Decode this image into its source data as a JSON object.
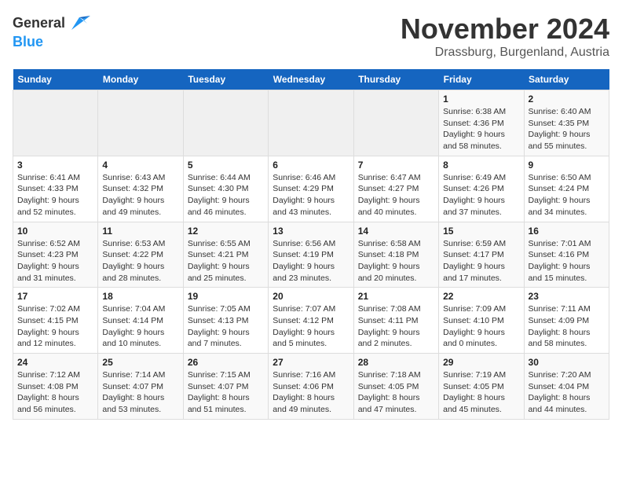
{
  "header": {
    "logo_general": "General",
    "logo_blue": "Blue",
    "month_title": "November 2024",
    "location": "Drassburg, Burgenland, Austria"
  },
  "weekdays": [
    "Sunday",
    "Monday",
    "Tuesday",
    "Wednesday",
    "Thursday",
    "Friday",
    "Saturday"
  ],
  "weeks": [
    [
      {
        "day": "",
        "details": ""
      },
      {
        "day": "",
        "details": ""
      },
      {
        "day": "",
        "details": ""
      },
      {
        "day": "",
        "details": ""
      },
      {
        "day": "",
        "details": ""
      },
      {
        "day": "1",
        "details": "Sunrise: 6:38 AM\nSunset: 4:36 PM\nDaylight: 9 hours and 58 minutes."
      },
      {
        "day": "2",
        "details": "Sunrise: 6:40 AM\nSunset: 4:35 PM\nDaylight: 9 hours and 55 minutes."
      }
    ],
    [
      {
        "day": "3",
        "details": "Sunrise: 6:41 AM\nSunset: 4:33 PM\nDaylight: 9 hours and 52 minutes."
      },
      {
        "day": "4",
        "details": "Sunrise: 6:43 AM\nSunset: 4:32 PM\nDaylight: 9 hours and 49 minutes."
      },
      {
        "day": "5",
        "details": "Sunrise: 6:44 AM\nSunset: 4:30 PM\nDaylight: 9 hours and 46 minutes."
      },
      {
        "day": "6",
        "details": "Sunrise: 6:46 AM\nSunset: 4:29 PM\nDaylight: 9 hours and 43 minutes."
      },
      {
        "day": "7",
        "details": "Sunrise: 6:47 AM\nSunset: 4:27 PM\nDaylight: 9 hours and 40 minutes."
      },
      {
        "day": "8",
        "details": "Sunrise: 6:49 AM\nSunset: 4:26 PM\nDaylight: 9 hours and 37 minutes."
      },
      {
        "day": "9",
        "details": "Sunrise: 6:50 AM\nSunset: 4:24 PM\nDaylight: 9 hours and 34 minutes."
      }
    ],
    [
      {
        "day": "10",
        "details": "Sunrise: 6:52 AM\nSunset: 4:23 PM\nDaylight: 9 hours and 31 minutes."
      },
      {
        "day": "11",
        "details": "Sunrise: 6:53 AM\nSunset: 4:22 PM\nDaylight: 9 hours and 28 minutes."
      },
      {
        "day": "12",
        "details": "Sunrise: 6:55 AM\nSunset: 4:21 PM\nDaylight: 9 hours and 25 minutes."
      },
      {
        "day": "13",
        "details": "Sunrise: 6:56 AM\nSunset: 4:19 PM\nDaylight: 9 hours and 23 minutes."
      },
      {
        "day": "14",
        "details": "Sunrise: 6:58 AM\nSunset: 4:18 PM\nDaylight: 9 hours and 20 minutes."
      },
      {
        "day": "15",
        "details": "Sunrise: 6:59 AM\nSunset: 4:17 PM\nDaylight: 9 hours and 17 minutes."
      },
      {
        "day": "16",
        "details": "Sunrise: 7:01 AM\nSunset: 4:16 PM\nDaylight: 9 hours and 15 minutes."
      }
    ],
    [
      {
        "day": "17",
        "details": "Sunrise: 7:02 AM\nSunset: 4:15 PM\nDaylight: 9 hours and 12 minutes."
      },
      {
        "day": "18",
        "details": "Sunrise: 7:04 AM\nSunset: 4:14 PM\nDaylight: 9 hours and 10 minutes."
      },
      {
        "day": "19",
        "details": "Sunrise: 7:05 AM\nSunset: 4:13 PM\nDaylight: 9 hours and 7 minutes."
      },
      {
        "day": "20",
        "details": "Sunrise: 7:07 AM\nSunset: 4:12 PM\nDaylight: 9 hours and 5 minutes."
      },
      {
        "day": "21",
        "details": "Sunrise: 7:08 AM\nSunset: 4:11 PM\nDaylight: 9 hours and 2 minutes."
      },
      {
        "day": "22",
        "details": "Sunrise: 7:09 AM\nSunset: 4:10 PM\nDaylight: 9 hours and 0 minutes."
      },
      {
        "day": "23",
        "details": "Sunrise: 7:11 AM\nSunset: 4:09 PM\nDaylight: 8 hours and 58 minutes."
      }
    ],
    [
      {
        "day": "24",
        "details": "Sunrise: 7:12 AM\nSunset: 4:08 PM\nDaylight: 8 hours and 56 minutes."
      },
      {
        "day": "25",
        "details": "Sunrise: 7:14 AM\nSunset: 4:07 PM\nDaylight: 8 hours and 53 minutes."
      },
      {
        "day": "26",
        "details": "Sunrise: 7:15 AM\nSunset: 4:07 PM\nDaylight: 8 hours and 51 minutes."
      },
      {
        "day": "27",
        "details": "Sunrise: 7:16 AM\nSunset: 4:06 PM\nDaylight: 8 hours and 49 minutes."
      },
      {
        "day": "28",
        "details": "Sunrise: 7:18 AM\nSunset: 4:05 PM\nDaylight: 8 hours and 47 minutes."
      },
      {
        "day": "29",
        "details": "Sunrise: 7:19 AM\nSunset: 4:05 PM\nDaylight: 8 hours and 45 minutes."
      },
      {
        "day": "30",
        "details": "Sunrise: 7:20 AM\nSunset: 4:04 PM\nDaylight: 8 hours and 44 minutes."
      }
    ]
  ]
}
